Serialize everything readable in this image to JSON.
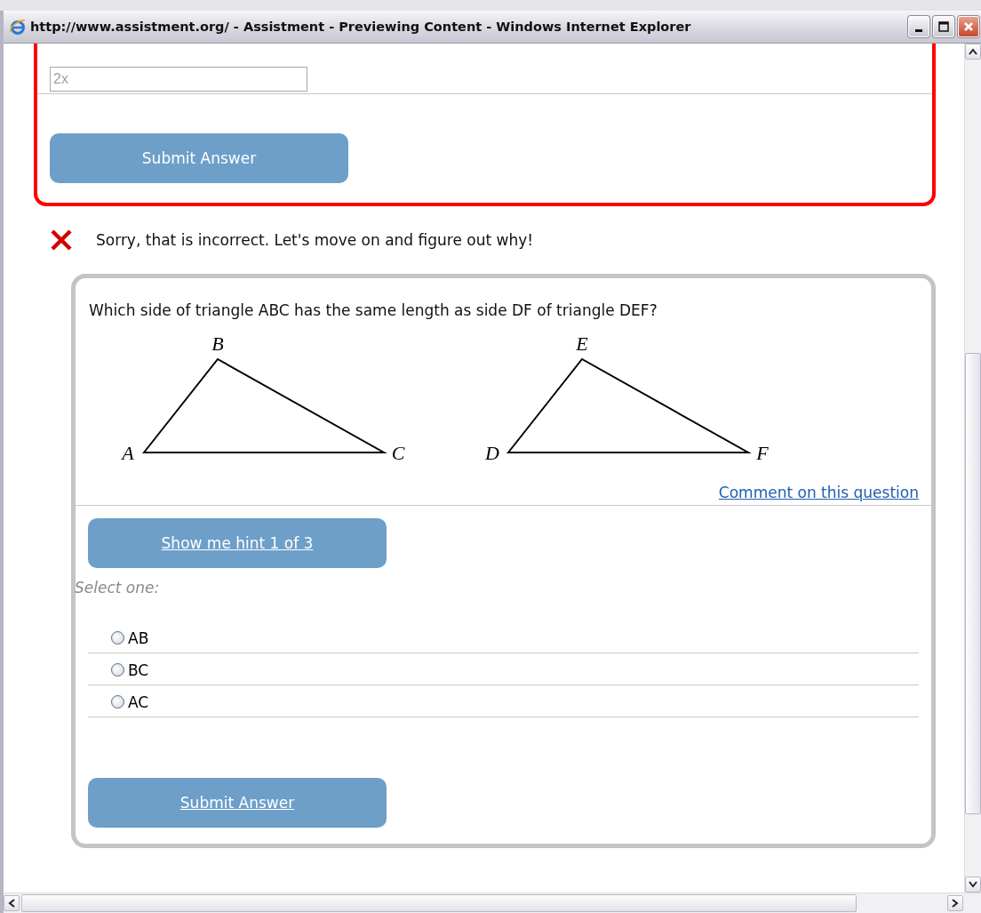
{
  "window": {
    "title": "http://www.assistment.org/ - Assistment - Previewing Content - Windows Internet Explorer"
  },
  "previous_question": {
    "answer_field": {
      "value": "2x",
      "disabled": true
    },
    "submit_button": "Submit Answer"
  },
  "feedback": {
    "kind": "incorrect",
    "message": "Sorry, that is incorrect. Let's move on and figure out why!"
  },
  "question": {
    "prompt": "Which side of triangle ABC has the same length as side DF of triangle DEF?",
    "figure": {
      "triangles": [
        {
          "vertices": [
            "A",
            "B",
            "C"
          ]
        },
        {
          "vertices": [
            "D",
            "E",
            "F"
          ]
        }
      ]
    },
    "comment_link": "Comment on this question",
    "hint_button": "Show me hint 1 of 3",
    "select_label": "Select one:",
    "options": [
      {
        "label": "AB",
        "selected": false
      },
      {
        "label": "BC",
        "selected": false
      },
      {
        "label": "AC",
        "selected": false
      }
    ],
    "submit_button": "Submit Answer"
  }
}
